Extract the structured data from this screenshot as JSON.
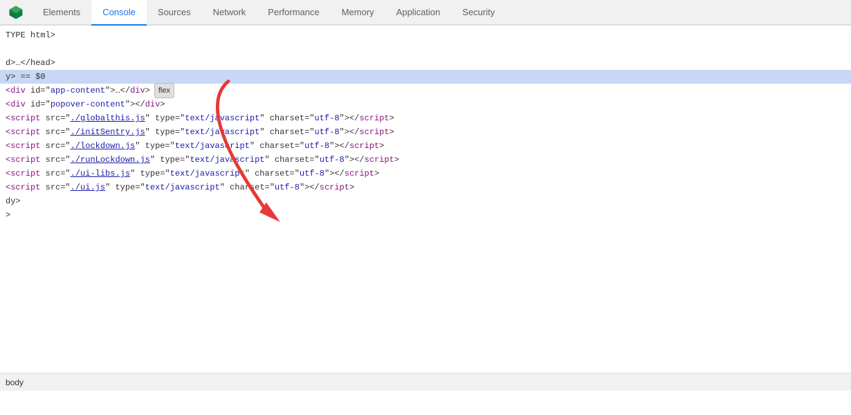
{
  "tabs": {
    "logo": "◆",
    "items": [
      {
        "id": "elements",
        "label": "Elements",
        "active": false
      },
      {
        "id": "console",
        "label": "Console",
        "active": true
      },
      {
        "id": "sources",
        "label": "Sources",
        "active": false
      },
      {
        "id": "network",
        "label": "Network",
        "active": false
      },
      {
        "id": "performance",
        "label": "Performance",
        "active": false
      },
      {
        "id": "memory",
        "label": "Memory",
        "active": false
      },
      {
        "id": "application",
        "label": "Application",
        "active": false
      },
      {
        "id": "security",
        "label": "Security",
        "active": false
      }
    ]
  },
  "code": {
    "lines": [
      {
        "id": "line1",
        "content": "TYPE html>",
        "highlighted": false
      },
      {
        "id": "line2",
        "content": "",
        "highlighted": false
      },
      {
        "id": "line3",
        "content": "d>…</head>",
        "highlighted": false
      },
      {
        "id": "line4",
        "content": "y> == $0",
        "highlighted": true,
        "has_dollar": true
      },
      {
        "id": "line5",
        "content_parts": [
          {
            "type": "tag",
            "text": "div"
          },
          {
            "type": "text",
            "text": " id=\""
          },
          {
            "type": "attr-value",
            "text": "app-content"
          },
          {
            "type": "text",
            "text": "\">…</"
          },
          {
            "type": "tag",
            "text": "div"
          },
          {
            "type": "text",
            "text": ">"
          }
        ],
        "has_badge": true,
        "badge": "flex",
        "highlighted": false
      },
      {
        "id": "line6",
        "content_parts": [
          {
            "type": "tag",
            "text": "div"
          },
          {
            "type": "text",
            "text": " id=\""
          },
          {
            "type": "attr-value",
            "text": "popover-content"
          },
          {
            "type": "text",
            "text": "\"></"
          },
          {
            "type": "tag",
            "text": "div"
          },
          {
            "type": "text",
            "text": ">"
          }
        ],
        "highlighted": false
      },
      {
        "id": "line7",
        "content_parts": [
          {
            "type": "tag",
            "text": "script"
          },
          {
            "type": "text",
            "text": " src=\""
          },
          {
            "type": "link",
            "text": "./globalthis.js"
          },
          {
            "type": "text",
            "text": "\" type=\""
          },
          {
            "type": "attr-value",
            "text": "text/javascript"
          },
          {
            "type": "text",
            "text": "\" charset=\""
          },
          {
            "type": "attr-value",
            "text": "utf-8"
          },
          {
            "type": "text",
            "text": "\"></"
          },
          {
            "type": "tag",
            "text": "script"
          },
          {
            "type": "text",
            "text": ">"
          }
        ],
        "highlighted": false
      },
      {
        "id": "line8",
        "content_parts": [
          {
            "type": "tag",
            "text": "script"
          },
          {
            "type": "text",
            "text": " src=\""
          },
          {
            "type": "link",
            "text": "./initSentry.js"
          },
          {
            "type": "text",
            "text": "\" type=\""
          },
          {
            "type": "attr-value",
            "text": "text/javascript"
          },
          {
            "type": "text",
            "text": "\" charset=\""
          },
          {
            "type": "attr-value",
            "text": "utf-8"
          },
          {
            "type": "text",
            "text": "\"></"
          },
          {
            "type": "tag",
            "text": "script"
          },
          {
            "type": "text",
            "text": ">"
          }
        ],
        "highlighted": false
      },
      {
        "id": "line9",
        "content_parts": [
          {
            "type": "tag",
            "text": "script"
          },
          {
            "type": "text",
            "text": " src=\""
          },
          {
            "type": "link",
            "text": "./lockdown.js"
          },
          {
            "type": "text",
            "text": "\" type=\""
          },
          {
            "type": "attr-value",
            "text": "text/javascript"
          },
          {
            "type": "text",
            "text": "\" charset=\""
          },
          {
            "type": "attr-value",
            "text": "utf-8"
          },
          {
            "type": "text",
            "text": "\"></"
          },
          {
            "type": "tag",
            "text": "script"
          },
          {
            "type": "text",
            "text": ">"
          }
        ],
        "highlighted": false
      },
      {
        "id": "line10",
        "content_parts": [
          {
            "type": "tag",
            "text": "script"
          },
          {
            "type": "text",
            "text": " src=\""
          },
          {
            "type": "link",
            "text": "./runLockdown.js"
          },
          {
            "type": "text",
            "text": "\" type=\""
          },
          {
            "type": "attr-value",
            "text": "text/javascript"
          },
          {
            "type": "text",
            "text": "\" charset=\""
          },
          {
            "type": "attr-value",
            "text": "utf-8"
          },
          {
            "type": "text",
            "text": "\"></"
          },
          {
            "type": "tag",
            "text": "script"
          },
          {
            "type": "text",
            "text": ">"
          }
        ],
        "highlighted": false
      },
      {
        "id": "line11",
        "content_parts": [
          {
            "type": "tag",
            "text": "script"
          },
          {
            "type": "text",
            "text": " src=\""
          },
          {
            "type": "link",
            "text": "./ui-libs.js"
          },
          {
            "type": "text",
            "text": "\" type=\""
          },
          {
            "type": "attr-value",
            "text": "text/javascript"
          },
          {
            "type": "text",
            "text": "\" charset=\""
          },
          {
            "type": "attr-value",
            "text": "utf-8"
          },
          {
            "type": "text",
            "text": "\"></"
          },
          {
            "type": "tag",
            "text": "script"
          },
          {
            "type": "text",
            "text": ">"
          }
        ],
        "highlighted": false
      },
      {
        "id": "line12",
        "content_parts": [
          {
            "type": "tag",
            "text": "script"
          },
          {
            "type": "text",
            "text": " src=\""
          },
          {
            "type": "link",
            "text": "./ui.js"
          },
          {
            "type": "text",
            "text": "\" type=\""
          },
          {
            "type": "attr-value",
            "text": "text/javascript"
          },
          {
            "type": "text",
            "text": "\" charset=\""
          },
          {
            "type": "attr-value",
            "text": "utf-8"
          },
          {
            "type": "text",
            "text": "\"></"
          },
          {
            "type": "tag",
            "text": "script"
          },
          {
            "type": "text",
            "text": ">"
          }
        ],
        "highlighted": false
      },
      {
        "id": "line13",
        "content": "dy>",
        "highlighted": false
      },
      {
        "id": "line14",
        "content": ">",
        "highlighted": false
      }
    ]
  },
  "status_bar": {
    "item": "body"
  }
}
